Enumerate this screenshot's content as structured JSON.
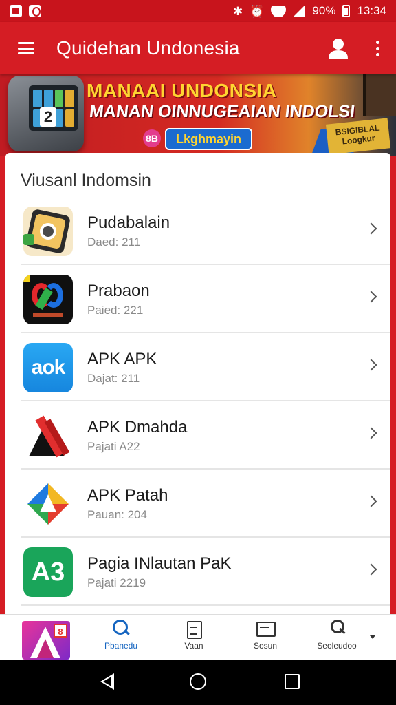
{
  "status_bar": {
    "battery": "90%",
    "time": "13:34"
  },
  "app_bar": {
    "title": "Quidehan Undonesia"
  },
  "banner": {
    "line1": "MANAAI UNDONSIA",
    "line2": "MANAN OINNUGEAIAN INDOLSI",
    "logo_text": "8B",
    "pill_text": "Lkghmayin",
    "tag_text": "BSIGIBLAL Loogkur",
    "device_number": "2"
  },
  "section": {
    "title": "Viusanl Indomsin"
  },
  "apps": [
    {
      "name": "Pudabalain",
      "meta": "Daed: 211",
      "icon": "camera-app-icon"
    },
    {
      "name": "Prabaon",
      "meta": "Paied: 221",
      "icon": "swirl-app-icon"
    },
    {
      "name": "APK APK",
      "meta": "Dajat: 211",
      "icon_text": "aok",
      "icon": "aok-app-icon"
    },
    {
      "name": "APK Dmahda",
      "meta": "Pajati A22",
      "icon": "red-a-app-icon"
    },
    {
      "name": "APK Patah",
      "meta": "Pauan: 204",
      "icon": "colorful-arrow-app-icon"
    },
    {
      "name": "Pagia INlautan PaK",
      "meta": "Pajati 2219",
      "icon_text": "A3",
      "icon": "green-a3-app-icon"
    }
  ],
  "bottom_nav": {
    "app_badge": "8",
    "items": [
      {
        "label": "Pbanedu",
        "icon": "search-icon",
        "active": true
      },
      {
        "label": "Vaan",
        "icon": "clipboard-icon",
        "active": false
      },
      {
        "label": "Sosun",
        "icon": "message-icon",
        "active": false
      },
      {
        "label": "Seoleudoo",
        "icon": "person-search-icon",
        "active": false
      }
    ]
  },
  "colors": {
    "brand_red": "#d51d24",
    "active_blue": "#1565c0"
  }
}
